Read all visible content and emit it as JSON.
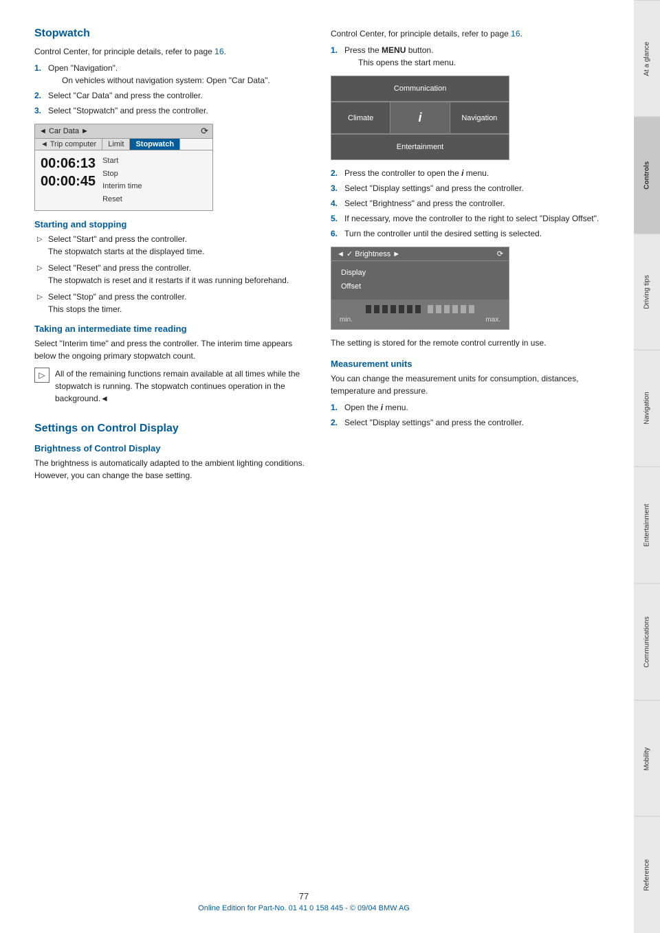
{
  "page": {
    "number": "77",
    "footer": "Online Edition for Part-No. 01 41 0 158 445 - © 09/04 BMW AG"
  },
  "sidebar": {
    "tabs": [
      {
        "label": "At a glance",
        "active": false
      },
      {
        "label": "Controls",
        "active": true
      },
      {
        "label": "Driving tips",
        "active": false
      },
      {
        "label": "Navigation",
        "active": false
      },
      {
        "label": "Entertainment",
        "active": false
      },
      {
        "label": "Communications",
        "active": false
      },
      {
        "label": "Mobility",
        "active": false
      },
      {
        "label": "Reference",
        "active": false
      }
    ]
  },
  "left_col": {
    "stopwatch": {
      "title": "Stopwatch",
      "intro": "Control Center, for principle details, refer to page ",
      "intro_link": "16",
      "intro_end": ".",
      "steps": [
        {
          "num": "1.",
          "text": "Open \"Navigation\".",
          "subtext": "On vehicles without navigation system: Open \"Car Data\"."
        },
        {
          "num": "2.",
          "text": "Select \"Car Data\" and press the controller."
        },
        {
          "num": "3.",
          "text": "Select \"Stopwatch\" and press the controller."
        }
      ],
      "screenshot": {
        "title": "Car Data",
        "tabs": [
          "Trip computer",
          "Limit",
          "Stopwatch"
        ],
        "time1": "00:06:13",
        "time2": "00:00:45",
        "menu_items": [
          "Start",
          "Stop",
          "Interim time",
          "Reset"
        ]
      }
    },
    "starting_stopping": {
      "title": "Starting and stopping",
      "bullets": [
        {
          "text": "Select \"Start\" and press the controller. The stopwatch starts at the displayed time."
        },
        {
          "text": "Select \"Reset\" and press the controller. The stopwatch is reset and it restarts if it was running beforehand."
        },
        {
          "text": "Select \"Stop\" and press the controller. This stops the timer."
        }
      ]
    },
    "interim_time": {
      "title": "Taking an intermediate time reading",
      "body": "Select \"Interim time\" and press the controller. The interim time appears below the ongoing primary stopwatch count.",
      "note": "All of the remaining functions remain available at all times while the stopwatch is running. The stopwatch continues operation in the background."
    },
    "settings": {
      "title": "Settings on Control Display",
      "brightness": {
        "title": "Brightness of Control Display",
        "body": "The brightness is automatically adapted to the ambient lighting conditions. However, you can change the base setting."
      }
    }
  },
  "right_col": {
    "intro": "Control Center, for principle details, refer to page ",
    "intro_link": "16",
    "intro_end": ".",
    "steps": [
      {
        "num": "1.",
        "text": "Press the ",
        "bold": "MENU",
        "text2": " button.",
        "subtext": "This opens the start menu."
      }
    ],
    "comm_screenshot": {
      "cells": [
        "Communication",
        "Climate",
        "i",
        "Navigation",
        "Entertainment"
      ]
    },
    "steps2": [
      {
        "num": "2.",
        "text": "Press the controller to open the i menu."
      },
      {
        "num": "3.",
        "text": "Select \"Display settings\" and press the controller."
      },
      {
        "num": "4.",
        "text": "Select \"Brightness\" and press the controller."
      },
      {
        "num": "5.",
        "text": "If necessary, move the controller to the right to select \"Display Offset\"."
      },
      {
        "num": "6.",
        "text": "Turn the controller until the desired setting is selected."
      }
    ],
    "brightness_screenshot": {
      "title": "Brightness",
      "options": [
        "Display",
        "Offset"
      ],
      "bar_label_min": "min.",
      "bar_label_max": "max."
    },
    "post_screenshot": "The setting is stored for the remote control currently in use.",
    "measurement": {
      "title": "Measurement units",
      "body": "You can change the measurement units for consumption, distances, temperature and pressure.",
      "steps": [
        {
          "num": "1.",
          "text": "Open the i menu."
        },
        {
          "num": "2.",
          "text": "Select \"Display settings\" and press the controller."
        }
      ]
    }
  }
}
